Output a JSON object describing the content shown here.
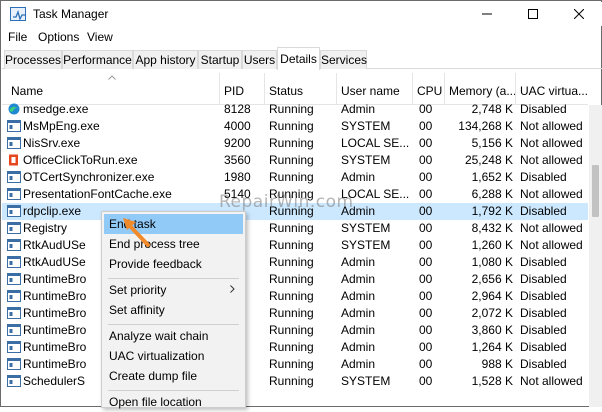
{
  "window": {
    "title": "Task Manager"
  },
  "menu": [
    "File",
    "Options",
    "View"
  ],
  "tabs": [
    {
      "label": "Processes",
      "active": false
    },
    {
      "label": "Performance",
      "active": false
    },
    {
      "label": "App history",
      "active": false
    },
    {
      "label": "Startup",
      "active": false
    },
    {
      "label": "Users",
      "active": false
    },
    {
      "label": "Details",
      "active": true
    },
    {
      "label": "Services",
      "active": false
    }
  ],
  "columns": [
    "Name",
    "PID",
    "Status",
    "User name",
    "CPU",
    "Memory (a...",
    "UAC virtua..."
  ],
  "rows": [
    {
      "name": "msedge.exe",
      "pid": "8128",
      "status": "Running",
      "user": "Admin",
      "cpu": "00",
      "mem": "2,748 K",
      "uac": "Disabled",
      "icon": "edge-icon"
    },
    {
      "name": "MsMpEng.exe",
      "pid": "4000",
      "status": "Running",
      "user": "SYSTEM",
      "cpu": "00",
      "mem": "134,268 K",
      "uac": "Not allowed",
      "icon": "app-window-icon"
    },
    {
      "name": "NisSrv.exe",
      "pid": "9200",
      "status": "Running",
      "user": "LOCAL SE...",
      "cpu": "00",
      "mem": "5,156 K",
      "uac": "Not allowed",
      "icon": "app-window-icon"
    },
    {
      "name": "OfficeClickToRun.exe",
      "pid": "3560",
      "status": "Running",
      "user": "SYSTEM",
      "cpu": "00",
      "mem": "25,248 K",
      "uac": "Not allowed",
      "icon": "office-icon"
    },
    {
      "name": "OTCertSynchronizer.exe",
      "pid": "1980",
      "status": "Running",
      "user": "Admin",
      "cpu": "00",
      "mem": "1,652 K",
      "uac": "Disabled",
      "icon": "app-window-icon"
    },
    {
      "name": "PresentationFontCache.exe",
      "pid": "5140",
      "status": "Running",
      "user": "LOCAL SE...",
      "cpu": "00",
      "mem": "6,288 K",
      "uac": "Not allowed",
      "icon": "app-window-icon"
    },
    {
      "name": "rdpclip.exe",
      "pid": "",
      "status": "Running",
      "user": "Admin",
      "cpu": "00",
      "mem": "1,792 K",
      "uac": "Disabled",
      "icon": "app-window-icon",
      "selected": true
    },
    {
      "name": "Registry",
      "pid": "",
      "status": "Running",
      "user": "SYSTEM",
      "cpu": "00",
      "mem": "8,432 K",
      "uac": "Not allowed",
      "icon": "app-window-icon"
    },
    {
      "name": "RtkAudUSe",
      "pid": "",
      "status": "Running",
      "user": "SYSTEM",
      "cpu": "00",
      "mem": "1,260 K",
      "uac": "Not allowed",
      "icon": "app-window-icon"
    },
    {
      "name": "RtkAudUSe",
      "pid": "",
      "status": "Running",
      "user": "Admin",
      "cpu": "00",
      "mem": "1,080 K",
      "uac": "Disabled",
      "icon": "app-window-icon"
    },
    {
      "name": "RuntimeBro",
      "pid": "",
      "status": "Running",
      "user": "Admin",
      "cpu": "00",
      "mem": "2,656 K",
      "uac": "Disabled",
      "icon": "app-window-icon"
    },
    {
      "name": "RuntimeBro",
      "pid": "",
      "status": "Running",
      "user": "Admin",
      "cpu": "00",
      "mem": "2,964 K",
      "uac": "Disabled",
      "icon": "app-window-icon"
    },
    {
      "name": "RuntimeBro",
      "pid": "",
      "status": "Running",
      "user": "Admin",
      "cpu": "00",
      "mem": "2,072 K",
      "uac": "Disabled",
      "icon": "app-window-icon"
    },
    {
      "name": "RuntimeBro",
      "pid": "",
      "status": "Running",
      "user": "Admin",
      "cpu": "00",
      "mem": "3,860 K",
      "uac": "Disabled",
      "icon": "app-window-icon"
    },
    {
      "name": "RuntimeBro",
      "pid": "",
      "status": "Running",
      "user": "Admin",
      "cpu": "00",
      "mem": "1,264 K",
      "uac": "Disabled",
      "icon": "app-window-icon"
    },
    {
      "name": "RuntimeBro",
      "pid": "",
      "status": "Running",
      "user": "Admin",
      "cpu": "00",
      "mem": "988 K",
      "uac": "Disabled",
      "icon": "app-window-icon"
    },
    {
      "name": "SchedulerS",
      "pid": "",
      "status": "Running",
      "user": "SYSTEM",
      "cpu": "00",
      "mem": "1,528 K",
      "uac": "Not allowed",
      "icon": "app-window-icon"
    }
  ],
  "context_menu": {
    "end_task": "End task",
    "end_process_tree": "End process tree",
    "provide_feedback": "Provide feedback",
    "set_priority": "Set priority",
    "set_affinity": "Set affinity",
    "analyze_wait_chain": "Analyze wait chain",
    "uac_virtualization": "UAC virtualization",
    "create_dump_file": "Create dump file",
    "open_file_location": "Open file location"
  },
  "watermark": "RepairWin.com",
  "colors": {
    "selected_row": "#cce8ff",
    "menu_hover": "#91c9f7",
    "arrow": "#f08a2b"
  }
}
